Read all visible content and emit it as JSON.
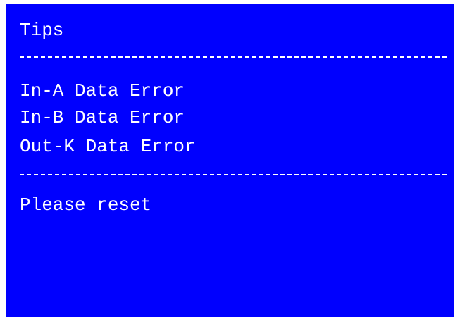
{
  "panel": {
    "title": "Tips",
    "errors": [
      "In-A Data Error",
      "In-B Data Error",
      "Out-K Data Error"
    ],
    "instruction": "Please reset"
  },
  "colors": {
    "background": "#0000fe",
    "text": "#ffffff",
    "page": "#ffffff"
  }
}
